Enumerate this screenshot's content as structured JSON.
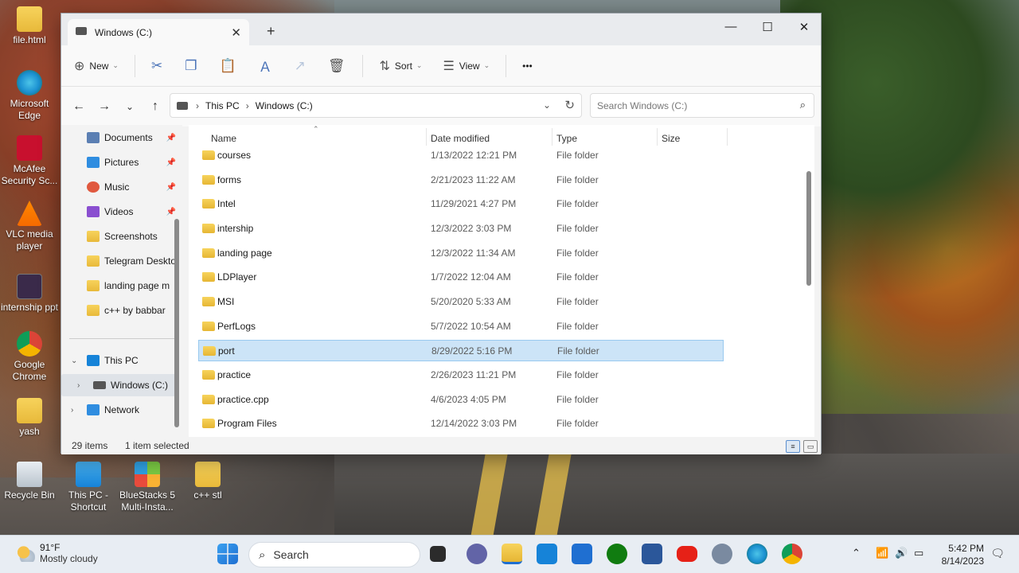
{
  "desktop": {
    "icons_left": [
      {
        "label": "file.html",
        "kind": "folder"
      },
      {
        "label": "Microsoft Edge",
        "kind": "edge"
      },
      {
        "label": "McAfee Security Sc...",
        "kind": "mcafee"
      },
      {
        "label": "VLC media player",
        "kind": "vlc"
      },
      {
        "label": "internship ppt",
        "kind": "ppt"
      },
      {
        "label": "Google Chrome",
        "kind": "chrome"
      },
      {
        "label": "yash",
        "kind": "folder"
      }
    ],
    "icons_bottom": [
      {
        "label": "Recycle Bin",
        "kind": "recycle"
      },
      {
        "label": "This PC - Shortcut",
        "kind": "pc"
      },
      {
        "label": "BlueStacks 5 Multi-Insta...",
        "kind": "bluestacks"
      },
      {
        "label": "c++ stl",
        "kind": "folder"
      }
    ]
  },
  "window": {
    "tab_title": "Windows (C:)",
    "new_tab_symbol": "+",
    "controls": {
      "minimize": "—",
      "maximize": "☐",
      "close": "✕"
    },
    "toolbar": {
      "new_label": "New",
      "sort_label": "Sort",
      "view_label": "View",
      "more_label": "•••"
    },
    "address": {
      "crumbs": [
        "This PC",
        "Windows (C:)"
      ],
      "search_placeholder": "Search Windows (C:)"
    },
    "sidebar": {
      "quick_access": [
        {
          "label": "Documents",
          "pinned": true,
          "color": "#5b7fb3"
        },
        {
          "label": "Pictures",
          "pinned": true,
          "color": "#2f8de0"
        },
        {
          "label": "Music",
          "pinned": true,
          "color": "#e0593f"
        },
        {
          "label": "Videos",
          "pinned": true,
          "color": "#8a4fd0"
        },
        {
          "label": "Screenshots",
          "pinned": false,
          "color": "#f0c64a"
        },
        {
          "label": "Telegram Deskto",
          "pinned": false,
          "color": "#f0c64a"
        },
        {
          "label": "landing page  m",
          "pinned": false,
          "color": "#f0c64a"
        },
        {
          "label": "c++ by babbar",
          "pinned": false,
          "color": "#f0c64a"
        }
      ],
      "this_pc": "This PC",
      "drive": "Windows (C:)",
      "network": "Network"
    },
    "columns": {
      "name": "Name",
      "date": "Date modified",
      "type": "Type",
      "size": "Size"
    },
    "files": [
      {
        "name": "courses",
        "date": "1/13/2022 12:21 PM",
        "type": "File folder"
      },
      {
        "name": "forms",
        "date": "2/21/2023 11:22 AM",
        "type": "File folder"
      },
      {
        "name": "Intel",
        "date": "11/29/2021 4:27 PM",
        "type": "File folder"
      },
      {
        "name": "intership",
        "date": "12/3/2022 3:03 PM",
        "type": "File folder"
      },
      {
        "name": "landing page",
        "date": "12/3/2022 11:34 AM",
        "type": "File folder"
      },
      {
        "name": "LDPlayer",
        "date": "1/7/2022 12:04 AM",
        "type": "File folder"
      },
      {
        "name": "MSI",
        "date": "5/20/2020 5:33 AM",
        "type": "File folder"
      },
      {
        "name": "PerfLogs",
        "date": "5/7/2022 10:54 AM",
        "type": "File folder"
      },
      {
        "name": "port",
        "date": "8/29/2022 5:16 PM",
        "type": "File folder",
        "selected": true
      },
      {
        "name": "practice",
        "date": "2/26/2023 11:21 PM",
        "type": "File folder"
      },
      {
        "name": "practice.cpp",
        "date": "4/6/2023 4:05 PM",
        "type": "File folder"
      },
      {
        "name": "Program Files",
        "date": "12/14/2022 3:03 PM",
        "type": "File folder"
      }
    ],
    "status": {
      "items": "29 items",
      "selected": "1 item selected"
    }
  },
  "taskbar": {
    "weather_temp": "91°F",
    "weather_desc": "Mostly cloudy",
    "search_label": "Search",
    "time": "5:42 PM",
    "date": "8/14/2023",
    "apps": [
      {
        "name": "windows-start",
        "color": "#1f6fd1"
      },
      {
        "name": "task-view",
        "color": "#2b2b2b"
      },
      {
        "name": "teams-chat",
        "color": "#6264a7"
      },
      {
        "name": "file-explorer",
        "color": "#f0c64a"
      },
      {
        "name": "this-pc",
        "color": "#1683d8"
      },
      {
        "name": "mail",
        "color": "#1f6fd1"
      },
      {
        "name": "xbox",
        "color": "#107c10"
      },
      {
        "name": "word",
        "color": "#2b579a"
      },
      {
        "name": "youtube",
        "color": "#e62117"
      },
      {
        "name": "whatsapp",
        "color": "#7a8aa0"
      },
      {
        "name": "edge",
        "color": "#1fa0d8"
      },
      {
        "name": "chrome",
        "color": "#db4437"
      }
    ]
  }
}
